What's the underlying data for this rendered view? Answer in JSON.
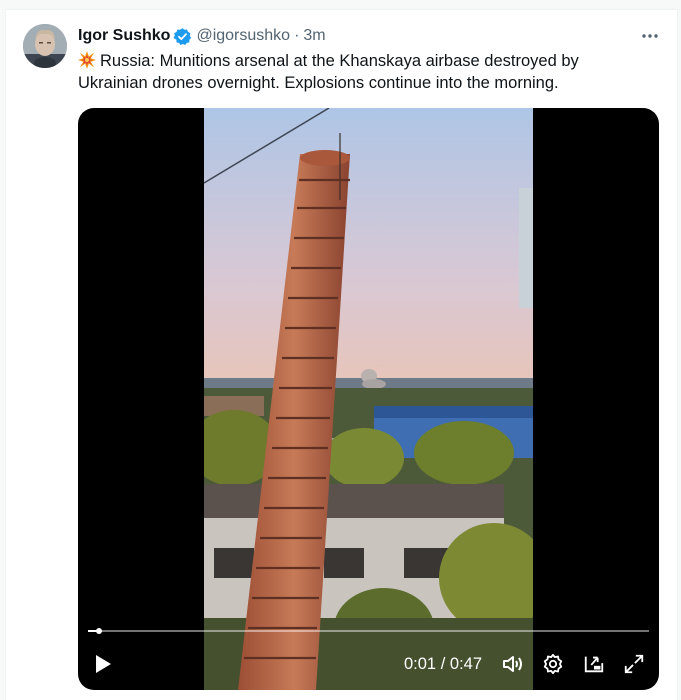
{
  "tweet": {
    "author_name": "Igor Sushko",
    "handle": "@igorsushko",
    "separator": "·",
    "time": "3m",
    "text": "Russia: Munitions arsenal at the Khanskaya airbase destroyed by Ukrainian drones overnight. Explosions continue into the morning.",
    "emoji": "collision-emoji"
  },
  "video": {
    "current_time": "0:01",
    "time_separator": "/",
    "duration": "0:47",
    "progress": 0.02,
    "controls": [
      "play-icon",
      "volume-icon",
      "settings-icon",
      "pip-icon",
      "fullscreen-icon"
    ]
  },
  "colors": {
    "verified": "#1d9bf0",
    "secondary_text": "#536471",
    "accent": "#ffffff"
  }
}
